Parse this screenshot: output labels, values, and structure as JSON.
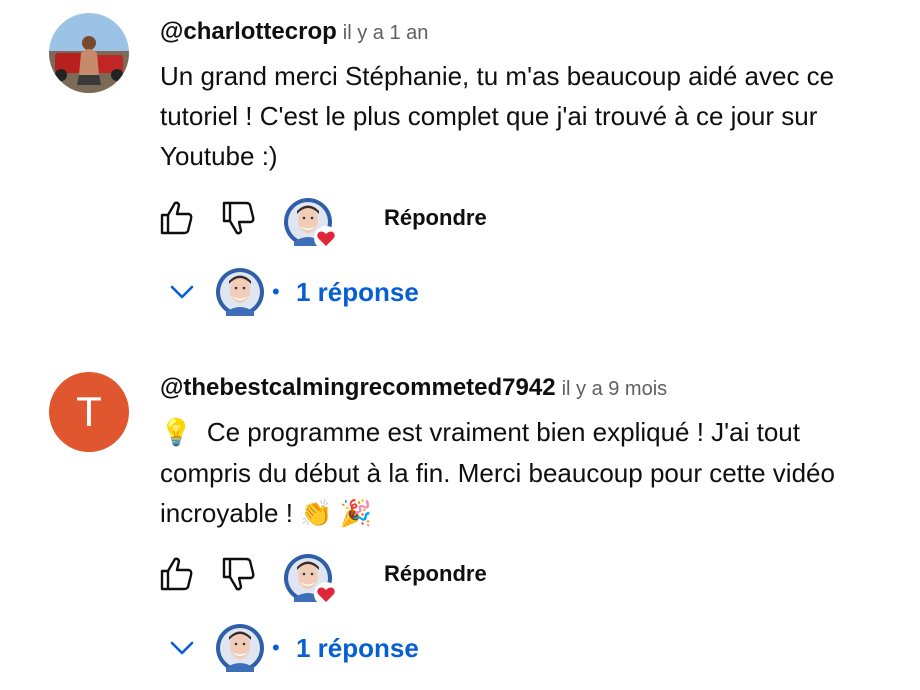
{
  "comments": [
    {
      "author": "@charlottecrop",
      "time": "il y a 1 an",
      "lines": [
        "Un grand merci Stéphanie, tu m'as beaucoup aidé avec ce",
        "tutoriel ! C'est le plus complet que j'ai trouvé à ce jour sur",
        "Youtube :)"
      ],
      "reply_label": "Répondre",
      "replies_label": "1 réponse",
      "avatar_icon": "photo-avatar"
    },
    {
      "author": "@thebestcalmingrecommeted7942",
      "time": "il y a 9 mois",
      "avatar_letter": "T",
      "lines": [
        "Ce programme est vraiment bien expliqué ! J'ai tout",
        "compris du début à la fin. Merci beaucoup pour cette vidéo",
        "incroyable !"
      ],
      "emojis": {
        "lightbulb": "💡",
        "clap": "👏",
        "party": "🎉"
      },
      "reply_label": "Répondre",
      "replies_label": "1 réponse"
    }
  ],
  "colors": {
    "link": "#065fd4",
    "avatar_t": "#e0562f",
    "heart": "#e0263b",
    "creator_bg": "#2e5fa8"
  },
  "icons": [
    "like-icon",
    "dislike-icon",
    "heart-icon",
    "chevron-down-icon"
  ]
}
